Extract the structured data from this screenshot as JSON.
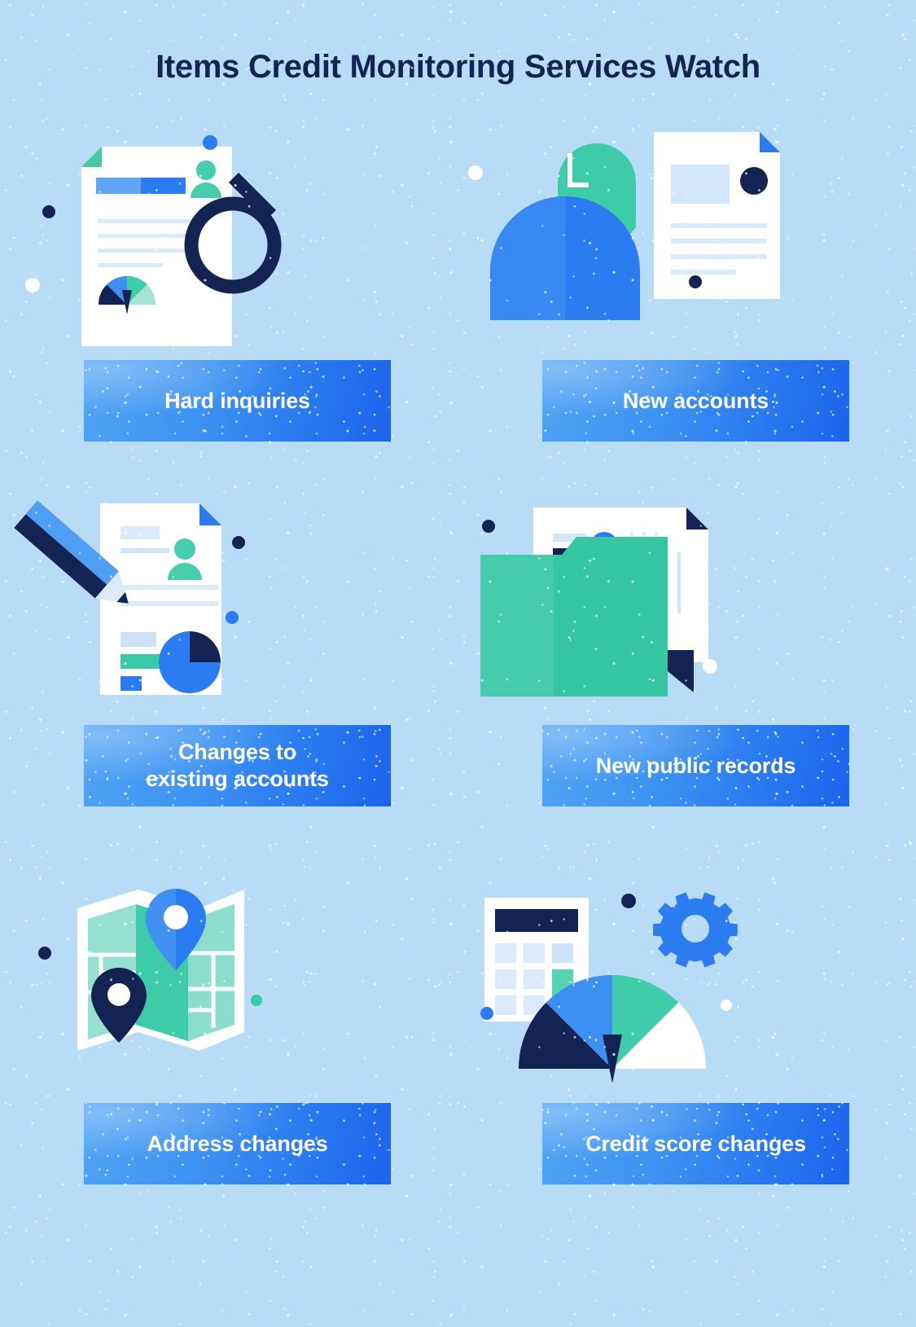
{
  "page": {
    "title": "Items Credit Monitoring Services Watch",
    "background_color": "#b8dcf6"
  },
  "colors": {
    "background": "#b8dcf6",
    "navy": "#132454",
    "blue": "#2b7cf0",
    "blue_light": "#5fa9f5",
    "teal": "#35c6a5",
    "mint": "#9ce0cf",
    "paper": "#ffffff",
    "line_light": "#d6e8fb",
    "bar_gradient_start": "#4fa3f5",
    "bar_gradient_end": "#1c63ec"
  },
  "items": [
    {
      "id": "hard-inquiries",
      "label": "Hard inquiries",
      "illustration": "document-with-magnifying-glass",
      "icons": [
        "document-icon",
        "magnifying-glass-icon",
        "person-avatar-icon",
        "gauge-chart-icon"
      ]
    },
    {
      "id": "new-accounts",
      "label": "New accounts",
      "illustration": "person-with-new-document",
      "icons": [
        "person-silhouette-icon",
        "speech-bubble-icon",
        "document-icon"
      ],
      "bubble_letter": "L"
    },
    {
      "id": "changes-to-existing-accounts",
      "label": "Changes to\nexisting accounts",
      "illustration": "document-with-pencil",
      "icons": [
        "document-icon",
        "pencil-icon",
        "person-avatar-icon",
        "pie-chart-icon"
      ]
    },
    {
      "id": "new-public-records",
      "label": "New public records",
      "illustration": "folder-with-record-document",
      "icons": [
        "folder-icon",
        "document-icon"
      ]
    },
    {
      "id": "address-changes",
      "label": "Address changes",
      "illustration": "folded-map-with-pins",
      "icons": [
        "map-icon",
        "map-pin-icon",
        "map-pin-icon"
      ]
    },
    {
      "id": "credit-score-changes",
      "label": "Credit score changes",
      "illustration": "calculator-gear-and-score-gauge",
      "icons": [
        "calculator-icon",
        "gear-icon",
        "gauge-chart-icon"
      ]
    }
  ]
}
